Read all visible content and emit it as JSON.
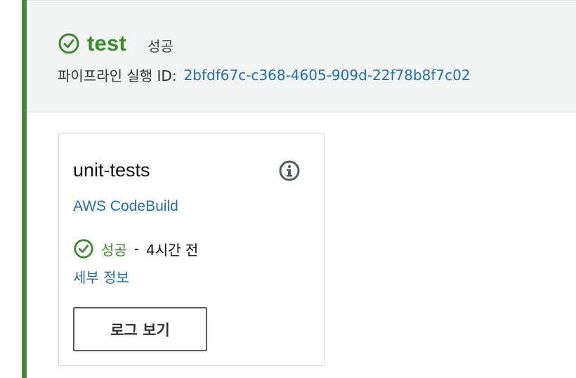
{
  "stage": {
    "name": "test",
    "status": "성공",
    "execution_label": "파이프라인 실행 ID:",
    "execution_id": "2bfdf67c-c368-4605-909d-22f78b8f7c02"
  },
  "action": {
    "name": "unit-tests",
    "provider": "AWS CodeBuild",
    "status": "성공",
    "separator": "-",
    "time": "4시간 전",
    "details_label": "세부 정보",
    "log_button_label": "로그 보기"
  },
  "icons": {
    "stage_status": "check-circle-icon",
    "action_status": "check-circle-icon",
    "info": "info-icon"
  },
  "colors": {
    "success": "#3b8a2e",
    "link": "#1f6fb0"
  }
}
